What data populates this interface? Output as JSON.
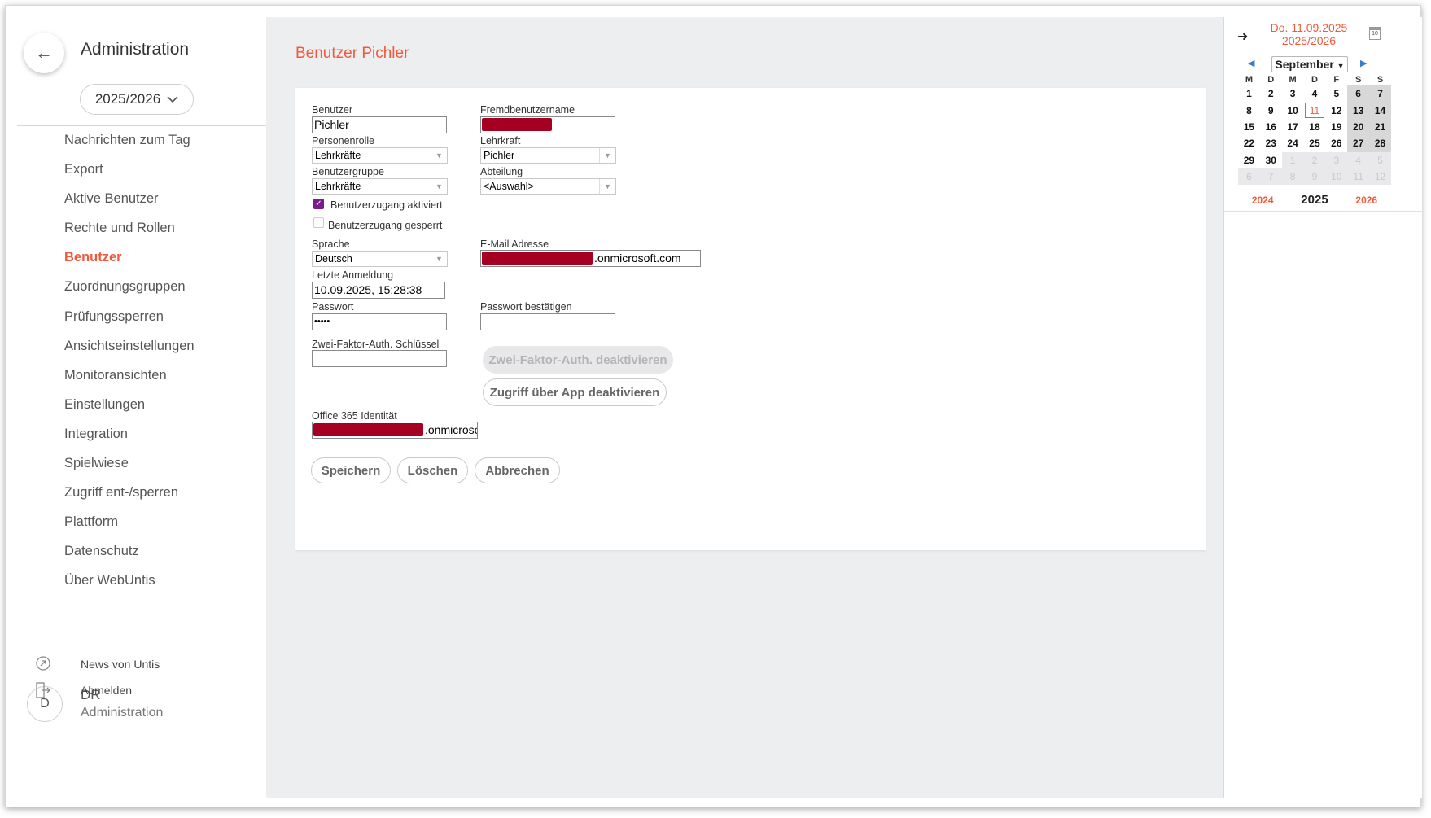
{
  "sidebar": {
    "back_icon": "arrow-left-icon",
    "title": "Administration",
    "school_year": "2025/2026",
    "nav_items": [
      "Nachrichten zum Tag",
      "Export",
      "Aktive Benutzer",
      "Rechte und Rollen",
      "Benutzer",
      "Zuordnungsgruppen",
      "Prüfungssperren",
      "Ansichtseinstellungen",
      "Monitoransichten",
      "Einstellungen",
      "Integration",
      "Spielwiese",
      "Zugriff ent-/sperren",
      "Plattform",
      "Datenschutz",
      "Über WebUntis"
    ],
    "active_item": "Benutzer",
    "user": {
      "avatar_letter": "D",
      "name": "DR",
      "role": "Administration"
    },
    "news_label": "News von Untis",
    "logout_label": "Abmelden"
  },
  "page": {
    "title": "Benutzer Pichler",
    "accent_color": "#f05a3c"
  },
  "form": {
    "benutzer_label": "Benutzer",
    "benutzer_value": "Pichler",
    "fremd_label": "Fremdbenutzername",
    "personenrolle_label": "Personenrolle",
    "personenrolle_value": "Lehrkräfte",
    "lehrkraft_label": "Lehrkraft",
    "lehrkraft_value": "Pichler",
    "benutzergruppe_label": "Benutzergruppe",
    "benutzergruppe_value": "Lehrkräfte",
    "abteilung_label": "Abteilung",
    "abteilung_value": "<Auswahl>",
    "zugang_aktiviert_label": "Benutzerzugang aktiviert",
    "zugang_aktiviert_checked": true,
    "zugang_gesperrt_label": "Benutzerzugang gesperrt",
    "zugang_gesperrt_checked": false,
    "sprache_label": "Sprache",
    "sprache_value": "Deutsch",
    "email_label": "E-Mail Adresse",
    "email_suffix": ".onmicrosoft.com",
    "letzte_label": "Letzte Anmeldung",
    "letzte_value": "10.09.2025, 15:28:38",
    "passwort_label": "Passwort",
    "passwort_value": "•••••",
    "passwort2_label": "Passwort bestätigen",
    "zwei_faktor_label": "Zwei-Faktor-Auth. Schlüssel",
    "btn_2fa_deactivate": "Zwei-Faktor-Auth. deaktivieren",
    "btn_app_deactivate": "Zugriff über App deaktivieren",
    "office_label": "Office 365 Identität",
    "office_suffix": ".onmicroso",
    "btn_save": "Speichern",
    "btn_delete": "Löschen",
    "btn_cancel": "Abbrechen",
    "redaction_color": "#a50021"
  },
  "calendar": {
    "date_line1": "Do. 11.09.2025",
    "date_line2": "2025/2026",
    "month": "September",
    "weekdays": [
      "M",
      "D",
      "M",
      "D",
      "F",
      "S",
      "S"
    ],
    "weeks": [
      [
        "1",
        "2",
        "3",
        "4",
        "5",
        "6",
        "7"
      ],
      [
        "8",
        "9",
        "10",
        "11",
        "12",
        "13",
        "14"
      ],
      [
        "15",
        "16",
        "17",
        "18",
        "19",
        "20",
        "21"
      ],
      [
        "22",
        "23",
        "24",
        "25",
        "26",
        "27",
        "28"
      ],
      [
        "29",
        "30",
        "1",
        "2",
        "3",
        "4",
        "5"
      ],
      [
        "6",
        "7",
        "8",
        "9",
        "10",
        "11",
        "12"
      ]
    ],
    "today": "11",
    "year_prev": "2024",
    "year_current": "2025",
    "year_next": "2026"
  }
}
